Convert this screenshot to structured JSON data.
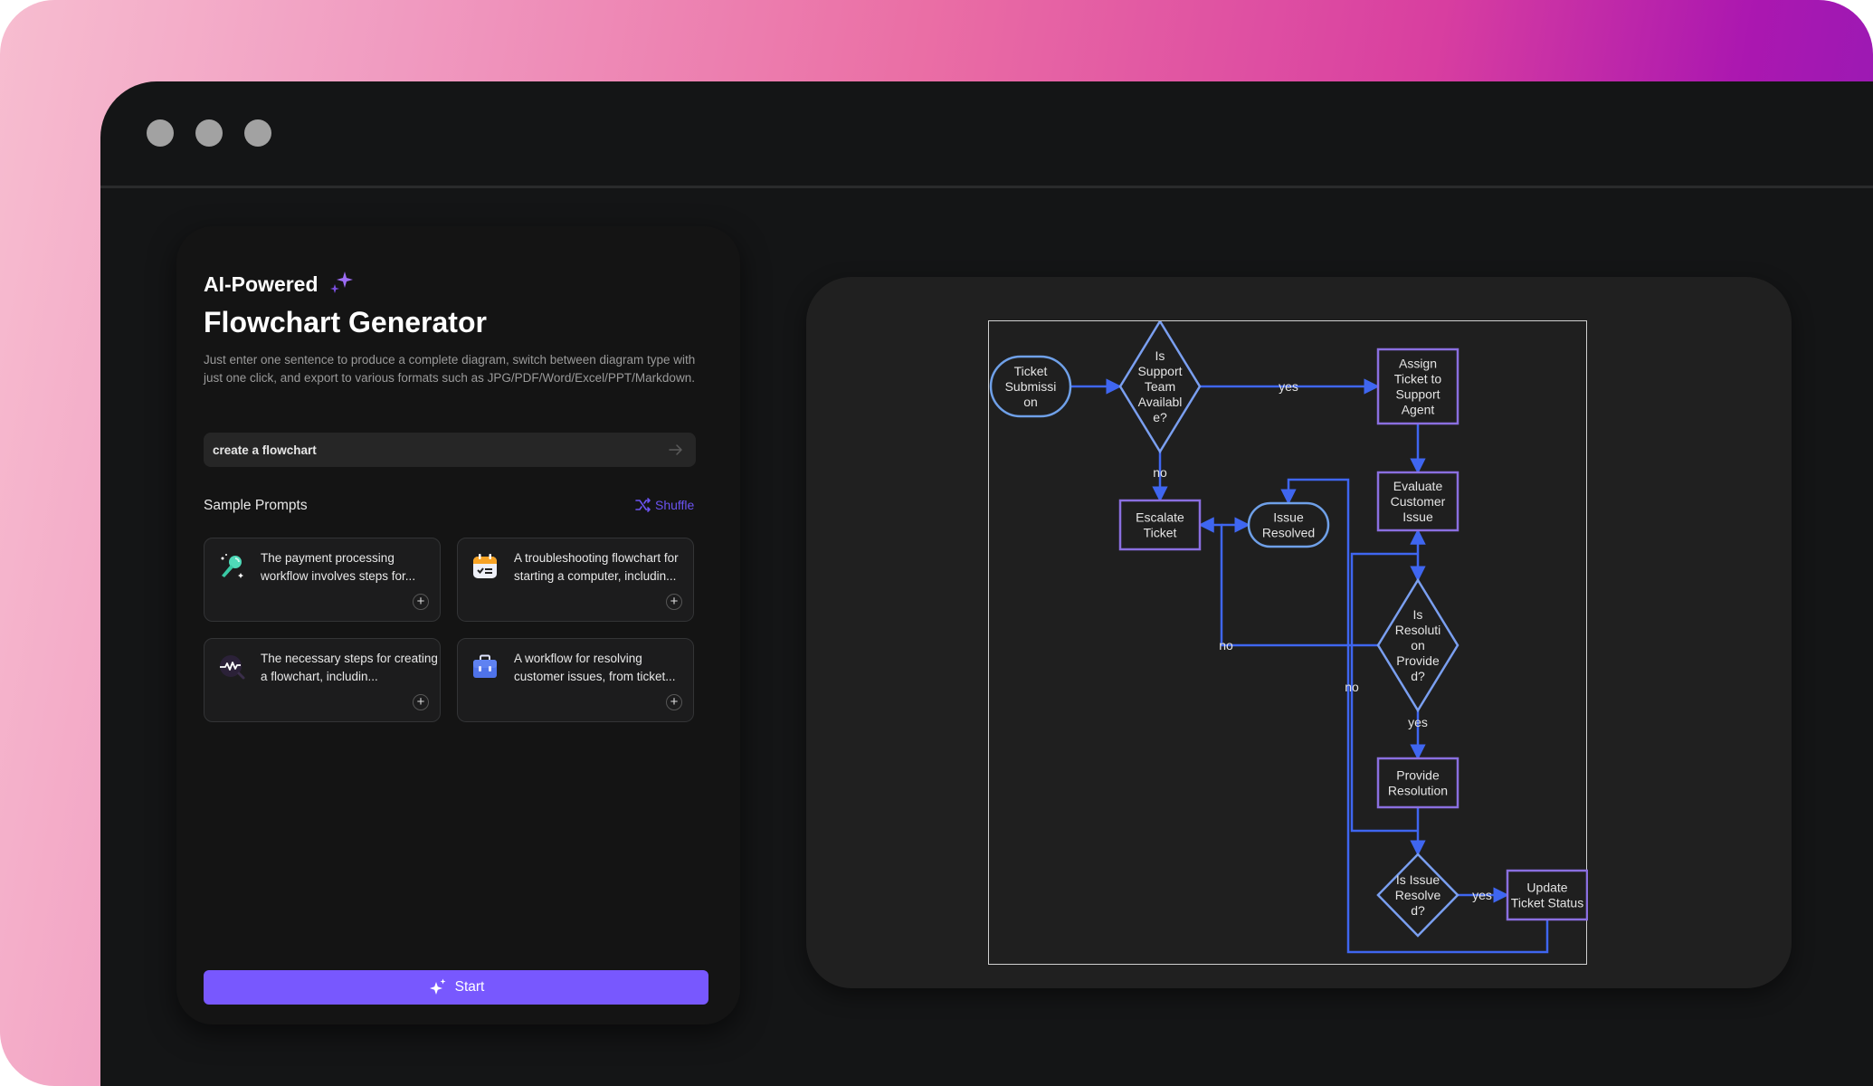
{
  "window": {
    "controls": [
      "close",
      "minimize",
      "maximize"
    ]
  },
  "hero": {
    "eyebrow": "AI-Powered",
    "eyebrow_icon": "sparkle-icon",
    "title": "Flowchart Generator",
    "description": "Just enter one sentence to produce a complete diagram, switch between diagram type with just one click, and export to various formats such as JPG/PDF/Word/Excel/PPT/Markdown."
  },
  "prompt_input": {
    "value": "create a flowchart",
    "placeholder": "",
    "submit_icon": "arrow-right-icon"
  },
  "samples": {
    "title": "Sample Prompts",
    "shuffle_label": "Shuffle",
    "cards": [
      {
        "icon": "microphone-icon",
        "text": "The payment processing workflow involves steps for..."
      },
      {
        "icon": "calendar-checklist-icon",
        "text": "A troubleshooting flowchart for starting a computer, includin..."
      },
      {
        "icon": "waveform-search-icon",
        "text": "The necessary steps for creating a flowchart, includin..."
      },
      {
        "icon": "briefcase-icon",
        "text": "A workflow for resolving customer issues, from ticket..."
      }
    ]
  },
  "start_button": {
    "label": "Start",
    "icon": "sparkle-icon"
  },
  "accent_color": "#7858fe",
  "diagram": {
    "nodes": [
      {
        "id": "n1",
        "shape": "terminal",
        "lines": [
          "Ticket",
          "Submissi",
          "on"
        ]
      },
      {
        "id": "n2",
        "shape": "decision",
        "lines": [
          "Is",
          "Support",
          "Team",
          "Availabl",
          "e?"
        ]
      },
      {
        "id": "n3",
        "shape": "process",
        "lines": [
          "Assign",
          "Ticket to",
          "Support",
          "Agent"
        ]
      },
      {
        "id": "n4",
        "shape": "process",
        "lines": [
          "Escalate",
          "Ticket"
        ]
      },
      {
        "id": "n5",
        "shape": "terminal",
        "lines": [
          "Issue",
          "Resolved"
        ]
      },
      {
        "id": "n6",
        "shape": "process",
        "lines": [
          "Evaluate",
          "Customer",
          "Issue"
        ]
      },
      {
        "id": "n7",
        "shape": "decision",
        "lines": [
          "Is",
          "Resoluti",
          "on",
          "Provide",
          "d?"
        ]
      },
      {
        "id": "n8",
        "shape": "process",
        "lines": [
          "Provide",
          "Resolution"
        ]
      },
      {
        "id": "n9",
        "shape": "decision",
        "lines": [
          "Is Issue",
          "Resolve",
          "d?"
        ]
      },
      {
        "id": "n10",
        "shape": "process",
        "lines": [
          "Update",
          "Ticket Status"
        ]
      }
    ],
    "edges": [
      {
        "from": "n1",
        "to": "n2",
        "label": ""
      },
      {
        "from": "n2",
        "to": "n3",
        "label": "yes"
      },
      {
        "from": "n2",
        "to": "n4",
        "label": "no"
      },
      {
        "from": "n3",
        "to": "n6",
        "label": ""
      },
      {
        "from": "n6",
        "to": "n7",
        "label": ""
      },
      {
        "from": "n7",
        "to": "n8",
        "label": "yes"
      },
      {
        "from": "n7",
        "to": "n4",
        "label": "no"
      },
      {
        "from": "n7",
        "to": "n5",
        "label": "no"
      },
      {
        "from": "n8",
        "to": "n9",
        "label": ""
      },
      {
        "from": "n9",
        "to": "n10",
        "label": "yes"
      },
      {
        "from": "n9",
        "to": "n6",
        "label": "no"
      },
      {
        "from": "n10",
        "to": "n5",
        "label": ""
      }
    ],
    "colors": {
      "edge": "#3f66f0",
      "terminal": "#6fa0e8",
      "decision": "#7a9ff0",
      "process": "#8a6fe0"
    }
  }
}
